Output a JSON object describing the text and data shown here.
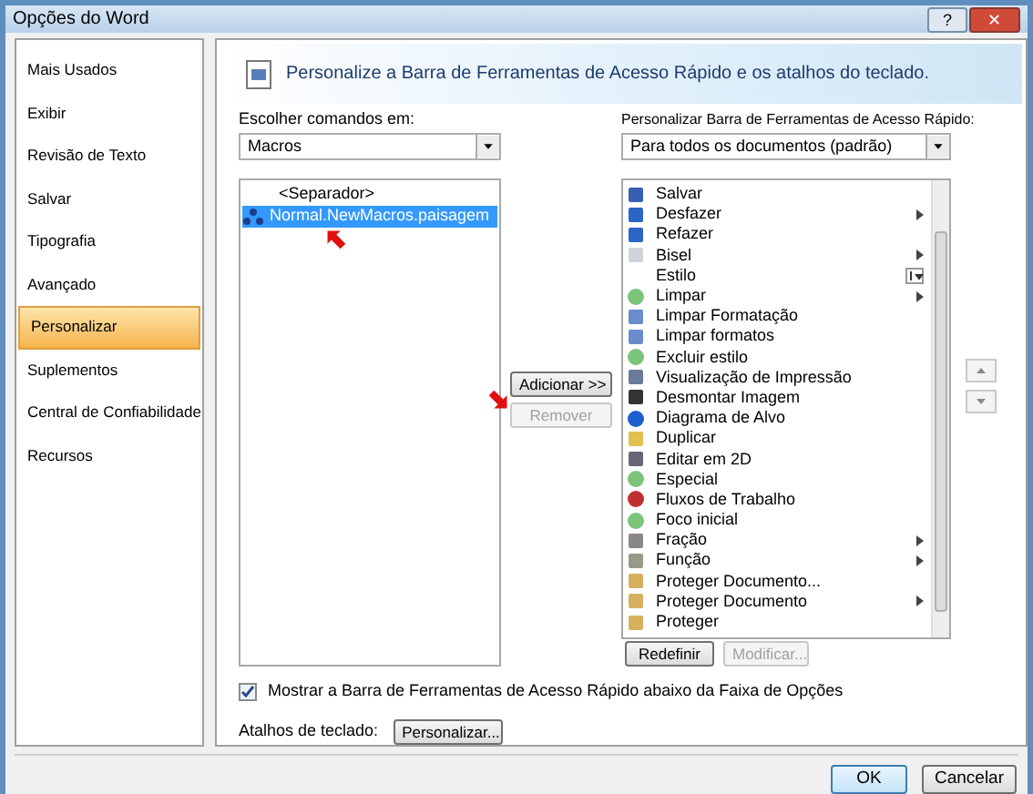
{
  "window": {
    "title": "Opções do Word",
    "help": "?",
    "close": "✕"
  },
  "sidebar": {
    "items": [
      {
        "label": "Mais Usados",
        "selected": false
      },
      {
        "label": "Exibir",
        "selected": false
      },
      {
        "label": "Revisão de Texto",
        "selected": false
      },
      {
        "label": "Salvar",
        "selected": false
      },
      {
        "label": "Tipografia",
        "selected": false
      },
      {
        "label": "Avançado",
        "selected": false
      },
      {
        "label": "Personalizar",
        "selected": true
      },
      {
        "label": "Suplementos",
        "selected": false
      },
      {
        "label": "Central de Confiabilidade",
        "selected": false
      },
      {
        "label": "Recursos",
        "selected": false
      }
    ]
  },
  "header": {
    "title": "Personalize a Barra de Ferramentas de Acesso Rápido e os atalhos do teclado."
  },
  "commands": {
    "label": "Escolher comandos em:",
    "dropdown": "Macros",
    "items": [
      {
        "label": "<Separador>",
        "selected": false,
        "kind": "separator"
      },
      {
        "label": "Normal.NewMacros.paisagem",
        "selected": true,
        "kind": "macro"
      }
    ]
  },
  "toolbar": {
    "label": "Personalizar Barra de Ferramentas de Acesso Rápido:",
    "dropdown": "Para todos os documentos (padrão)",
    "items": [
      {
        "label": "Salvar",
        "kind": "plain"
      },
      {
        "label": "Desfazer",
        "kind": "submenu"
      },
      {
        "label": "Refazer",
        "kind": "plain"
      },
      {
        "label": "Bisel",
        "kind": "submenu"
      },
      {
        "label": "Estilo",
        "kind": "combo"
      },
      {
        "label": "Limpar",
        "kind": "submenu"
      },
      {
        "label": "Limpar Formatação",
        "kind": "plain"
      },
      {
        "label": "Limpar formatos",
        "kind": "plain"
      },
      {
        "label": "Excluir estilo",
        "kind": "plain"
      },
      {
        "label": "Visualização de Impressão",
        "kind": "plain"
      },
      {
        "label": "Desmontar Imagem",
        "kind": "plain"
      },
      {
        "label": "Diagrama de Alvo",
        "kind": "plain"
      },
      {
        "label": "Duplicar",
        "kind": "plain"
      },
      {
        "label": "Editar em 2D",
        "kind": "plain"
      },
      {
        "label": "Especial",
        "kind": "plain"
      },
      {
        "label": "Fluxos de Trabalho",
        "kind": "plain"
      },
      {
        "label": "Foco inicial",
        "kind": "plain"
      },
      {
        "label": "Fração",
        "kind": "submenu"
      },
      {
        "label": "Função",
        "kind": "submenu"
      },
      {
        "label": "Proteger Documento...",
        "kind": "plain"
      },
      {
        "label": "Proteger Documento",
        "kind": "submenu"
      },
      {
        "label": "Proteger",
        "kind": "plain"
      }
    ]
  },
  "add_button": {
    "label": "Adicionar >>",
    "disabled": false
  },
  "remove_button": {
    "label": "Remover",
    "disabled": true
  },
  "reset_button": {
    "label": "Redefinir",
    "disabled": false
  },
  "modify_button": {
    "label": "Modificar...",
    "disabled": true
  },
  "show_below": {
    "label": "Mostrar a Barra de Ferramentas de Acesso Rápido abaixo da Faixa de Opções",
    "checked": true
  },
  "shortcuts": {
    "label": "Atalhos de teclado:",
    "button": "Personalizar..."
  },
  "footer": {
    "ok": "OK",
    "cancel": "Cancelar"
  }
}
